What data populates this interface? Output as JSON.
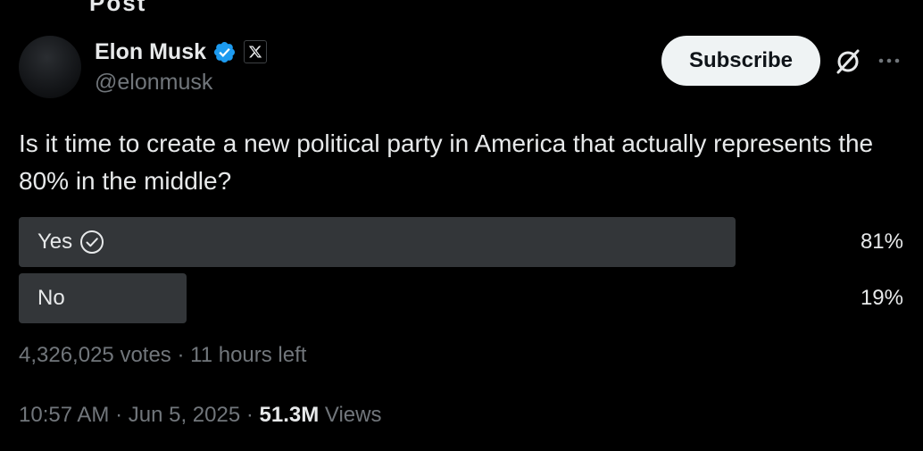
{
  "header": {
    "top_cut_text": "Post"
  },
  "author": {
    "name": "Elon Musk",
    "handle": "@elonmusk",
    "verified_color": "#1d9bf0",
    "affiliate_badge_icon": "x-logo-icon"
  },
  "actions": {
    "subscribe_label": "Subscribe",
    "grok_icon": "grok-icon",
    "more_icon": "more-dots-icon"
  },
  "tweet": {
    "text": "Is it time to create a new political party in America that actually represents the 80% in the middle?"
  },
  "poll": {
    "options": [
      {
        "label": "Yes",
        "percent": 81,
        "percent_label": "81%",
        "selected": true
      },
      {
        "label": "No",
        "percent": 19,
        "percent_label": "19%",
        "selected": false
      }
    ],
    "votes": "4,326,025 votes",
    "separator": " · ",
    "time_left": "11 hours left",
    "bar_color": "#333639"
  },
  "meta": {
    "time": "10:57 AM",
    "separator": " · ",
    "date": "Jun 5, 2025",
    "views_count": "51.3M",
    "views_label": "Views"
  }
}
